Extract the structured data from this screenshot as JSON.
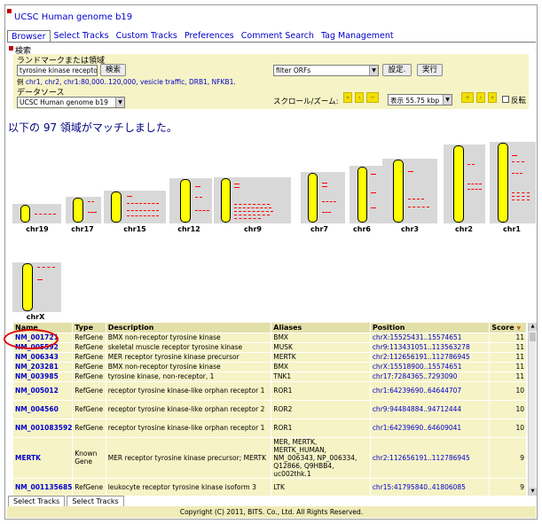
{
  "app": {
    "title": "UCSC Human genome b19"
  },
  "tabs": [
    "Browser",
    "Select Tracks",
    "Custom Tracks",
    "Preferences",
    "Comment Search",
    "Tag Management"
  ],
  "search": {
    "section_title": "検索",
    "landmark_label": "ランドマークまたは領域",
    "landmark_value": "tyrosine kinase receptor",
    "search_button": "検索",
    "examples_prefix": "例",
    "examples": "chr1, chr2, chr1:80,000..120,000, vesicle traffic, DRB1, NFKB1.",
    "filter_value": "filter ORFs",
    "settings_button": "設定.",
    "run_button": "実行",
    "datasource_label": "データソース",
    "datasource_value": "UCSC Human genome b19",
    "scroll_label": "スクロール/ズーム:",
    "zoom_value": "表示 55.75 kbp",
    "flip_label": "反転"
  },
  "result_message": "以下の 97 領域がマッチしました。",
  "chromosomes": [
    {
      "name": "chr19",
      "hits": 1
    },
    {
      "name": "chr17",
      "hits": 2
    },
    {
      "name": "chr15",
      "hits": 4
    },
    {
      "name": "chr12",
      "hits": 3
    },
    {
      "name": "chr9",
      "hits": 7
    },
    {
      "name": "chr7",
      "hits": 4
    },
    {
      "name": "chr6",
      "hits": 3
    },
    {
      "name": "chr3",
      "hits": 3
    },
    {
      "name": "chr2",
      "hits": 3
    },
    {
      "name": "chr1",
      "hits": 6
    },
    {
      "name": "chrX",
      "hits": 2
    }
  ],
  "table": {
    "headers": [
      "Name",
      "Type",
      "Description",
      "Aliases",
      "Position",
      "Score"
    ],
    "rows": [
      {
        "name": "NM_001721",
        "type": "RefGene",
        "desc": "BMX non-receptor tyrosine kinase",
        "aliases": "BMX",
        "pos": "chrX:15525431..15574651",
        "score": "11"
      },
      {
        "name": "NM_005592",
        "type": "RefGene",
        "desc": "skeletal muscle receptor tyrosine kinase",
        "aliases": "MUSK",
        "pos": "chr9:113431051..113563278",
        "score": "11"
      },
      {
        "name": "NM_006343",
        "type": "RefGene",
        "desc": "MER receptor tyrosine kinase precursor",
        "aliases": "MERTK",
        "pos": "chr2:112656191..112786945",
        "score": "11"
      },
      {
        "name": "NM_203281",
        "type": "RefGene",
        "desc": "BMX non-receptor tyrosine kinase",
        "aliases": "BMX",
        "pos": "chrX:15518900..15574651",
        "score": "11"
      },
      {
        "name": "NM_003985",
        "type": "RefGene",
        "desc": "tyrosine kinase, non-receptor, 1",
        "aliases": "TNK1",
        "pos": "chr17:7284365..7293090",
        "score": "11"
      },
      {
        "name": "NM_005012",
        "type": "RefGene",
        "desc": "receptor tyrosine kinase-like orphan receptor 1",
        "aliases": "ROR1",
        "pos": "chr1:64239690..64644707",
        "score": "10"
      },
      {
        "name": "NM_004560",
        "type": "RefGene",
        "desc": "receptor tyrosine kinase-like orphan receptor 2",
        "aliases": "ROR2",
        "pos": "chr9:94484884..94712444",
        "score": "10"
      },
      {
        "name": "NM_001083592",
        "type": "RefGene",
        "desc": "receptor tyrosine kinase-like orphan receptor 1",
        "aliases": "ROR1",
        "pos": "chr1:64239690..64609041",
        "score": "10"
      },
      {
        "name": "MERTK",
        "type": "Known Gene",
        "desc": "MER receptor tyrosine kinase precursor; MERTK",
        "aliases": "MER, MERTK, MERTK_HUMAN, NM_006343, NP_006334, Q12866, Q9HBB4, uc002thk.1",
        "pos": "chr2:112656191..112786945",
        "score": "9"
      },
      {
        "name": "NM_001135685",
        "type": "RefGene",
        "desc": "leukocyte receptor tyrosine kinase isoform 3",
        "aliases": "LTK",
        "pos": "chr15:41795840..41806085",
        "score": "9"
      }
    ]
  },
  "bottom_tabs": [
    "Select Tracks",
    "Select Tracks"
  ],
  "footer": "Copyright (C) 2011, BITS. Co., Ltd. All Rights Reserved.",
  "colors": {
    "link": "#0000cc",
    "panel": "#f6f3c6",
    "chromosome": "#ffff00",
    "hit": "#ff0000",
    "highlight": "#e00000"
  }
}
